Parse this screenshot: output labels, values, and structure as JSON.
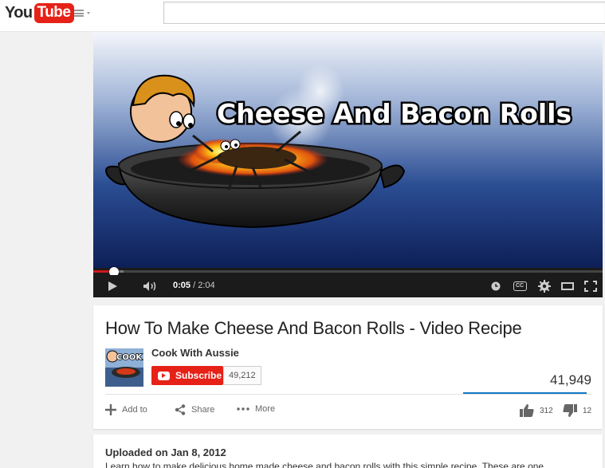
{
  "masthead": {
    "logo_you": "You",
    "logo_tube": "Tube",
    "search_value": "",
    "guide_icon": "hamburger-icon"
  },
  "player": {
    "overlay_title": "Cheese And Bacon Rolls",
    "current_time": "0:05",
    "time_separator": " / ",
    "duration": "2:04",
    "played_fraction": 0.04,
    "loaded_fraction": 0.06,
    "controls_icons": [
      "play-icon",
      "volume-icon",
      "watch-later-icon",
      "captions-icon",
      "settings-icon",
      "theater-mode-icon",
      "fullscreen-icon"
    ],
    "captions_label": "CC"
  },
  "video": {
    "title": "How To Make Cheese And Bacon Rolls - Video Recipe",
    "channel_name": "Cook With Aussie",
    "channel_thumb_text": "COOK",
    "subscribe_label": "Subscribe",
    "subscriber_count": "49,212",
    "view_count": "41,949",
    "like_ratio": 0.963,
    "actions": {
      "add_to": "Add to",
      "share": "Share",
      "more": "More"
    },
    "likes": "312",
    "dislikes": "12"
  },
  "description": {
    "upload_date": "Uploaded on Jan 8, 2012",
    "text": "Learn how to make delicious home made cheese and bacon rolls with this simple recipe. These are one"
  },
  "colors": {
    "brand_red": "#e62117",
    "progress_red": "#cc181e",
    "sentiment_blue": "#167ac6"
  }
}
